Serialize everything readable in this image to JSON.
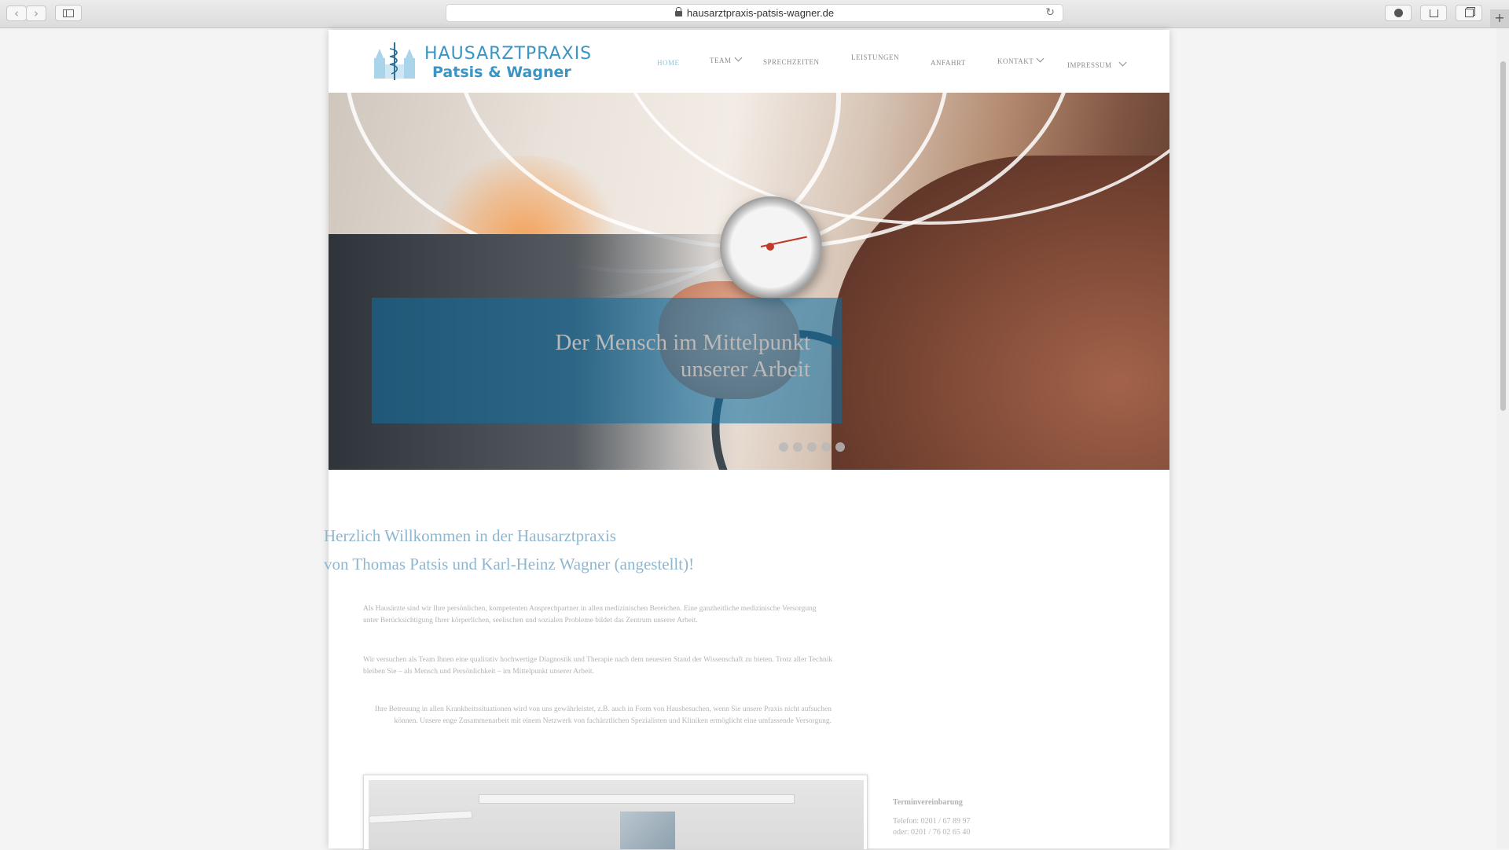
{
  "browser": {
    "url": "hausarztpraxis-patsis-wagner.de",
    "back_glyph": "‹",
    "forward_glyph": "›",
    "reload_glyph": "↻",
    "newtab_glyph": "+"
  },
  "logo": {
    "line1": "HAUSARZTPRAXIS",
    "line2": "Patsis & Wagner"
  },
  "nav": {
    "home": "HOME",
    "team": "TEAM",
    "sprechzeiten": "SPRECHZEITEN",
    "leistungen": "LEISTUNGEN",
    "anfahrt": "ANFAHRT",
    "kontakt": "KONTAKT",
    "impressum": "IMPRESSUM"
  },
  "hero": {
    "caption_line1": "Der Mensch im Mittelpunkt",
    "caption_line2": "unserer Arbeit",
    "slide_count": 5
  },
  "welcome": {
    "line1": "Herzlich Willkommen in der Hausarztpraxis",
    "line2": "von Thomas Patsis und Karl-Heinz Wagner (angestellt)!"
  },
  "paragraphs": {
    "p1": "Als Hausärzte sind wir Ihre persönlichen, kompetenten Ansprechpartner in allen medizinischen Bereichen. Eine ganzheitliche medizinische Versorgung unter Berücksichtigung Ihrer körperlichen, seelischen und sozialen Probleme bildet das Zentrum unserer Arbeit.",
    "p2": "Wir versuchen als Team Ihnen eine qualitativ hochwertige Diagnostik und Therapie nach dem neuesten Stand der Wissenschaft zu bieten. Trotz aller Technik bleiben Sie – als Mensch und Persönlichkeit – im Mittelpunkt unserer Arbeit.",
    "p3": "Ihre Betreuung in allen Krankheitssituationen wird von uns gewährleistet, z.B. auch in Form von Hausbesuchen, wenn Sie unsere Praxis nicht aufsuchen können. Unsere enge Zusammenarbeit mit einem Netzwerk von fachärztlichen Spezialisten und Kliniken ermöglicht eine umfassende Versorgung."
  },
  "sidebar": {
    "title": "Terminvereinbarung",
    "phone": "Telefon: 0201 / 67 89 97",
    "alt_phone": "oder: 0201 / 76 02 65 40"
  },
  "colors": {
    "accent": "#3a94c4",
    "caption_box": "#0f6ea0"
  }
}
